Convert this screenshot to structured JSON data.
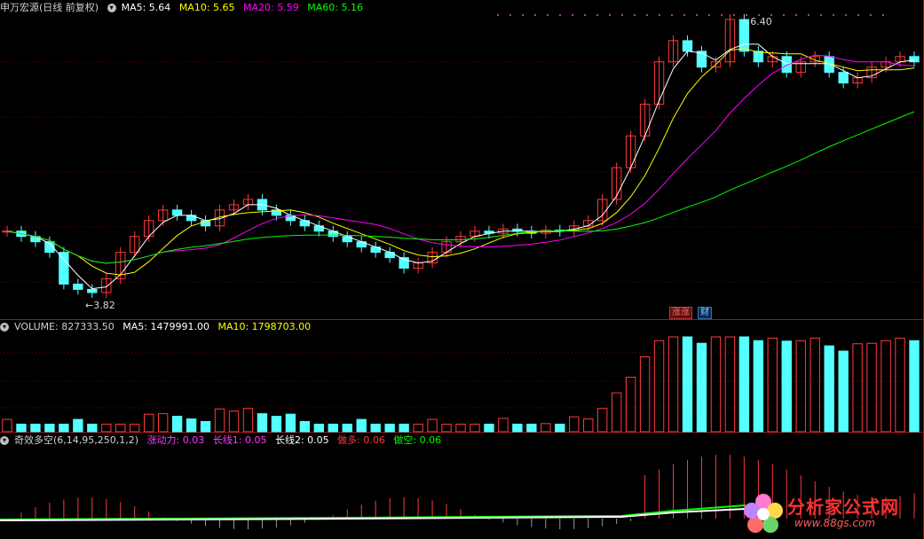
{
  "main": {
    "security": "申万宏源",
    "period": "(日线 前复权)",
    "ma5": "MA5: 5.64",
    "ma10": "MA10: 5.65",
    "ma20": "MA20: 5.59",
    "ma60": "MA60: 5.16",
    "high_label": "6.40",
    "low_label": "3.82",
    "badge1": "涨涨",
    "badge2": "财"
  },
  "volume": {
    "volume": "VOLUME: 827333.50",
    "ma5": "MA5: 1479991.00",
    "ma10": "MA10: 1798703.00"
  },
  "indicator": {
    "name": "奇效多空(6,14,95,250,1,2)",
    "zdl": "涨动力: 0.03",
    "cx1": "长线1: 0.05",
    "cx2": "长线2: 0.05",
    "zuoduo": "做多: 0.06",
    "zuokong": "做空: 0.06"
  },
  "logo": {
    "name": "分析家公式网",
    "url": "www.88gs.com"
  },
  "colors": {
    "up": "#ff3a3a",
    "down": "#54ffff",
    "ma5": "#ffffff",
    "ma10": "#ffff00",
    "ma20": "#ff00ff",
    "ma60": "#00ff00",
    "grid": "#7a0000"
  },
  "chart_data": {
    "type": "candlestick",
    "price_range": [
      3.82,
      6.4
    ],
    "prices": [
      4.4,
      4.35,
      4.3,
      4.2,
      3.9,
      3.85,
      3.82,
      3.95,
      4.2,
      4.35,
      4.5,
      4.6,
      4.55,
      4.5,
      4.45,
      4.6,
      4.65,
      4.7,
      4.6,
      4.55,
      4.5,
      4.45,
      4.4,
      4.35,
      4.3,
      4.25,
      4.2,
      4.15,
      4.05,
      4.1,
      4.2,
      4.3,
      4.35,
      4.4,
      4.38,
      4.42,
      4.4,
      4.38,
      4.41,
      4.4,
      4.45,
      4.5,
      4.7,
      5.0,
      5.3,
      5.6,
      6.0,
      6.2,
      6.1,
      5.95,
      6.0,
      6.4,
      6.1,
      6.0,
      6.05,
      5.9,
      6.0,
      6.05,
      5.9,
      5.8,
      5.85,
      5.95,
      6.0,
      6.05,
      6.0
    ]
  }
}
